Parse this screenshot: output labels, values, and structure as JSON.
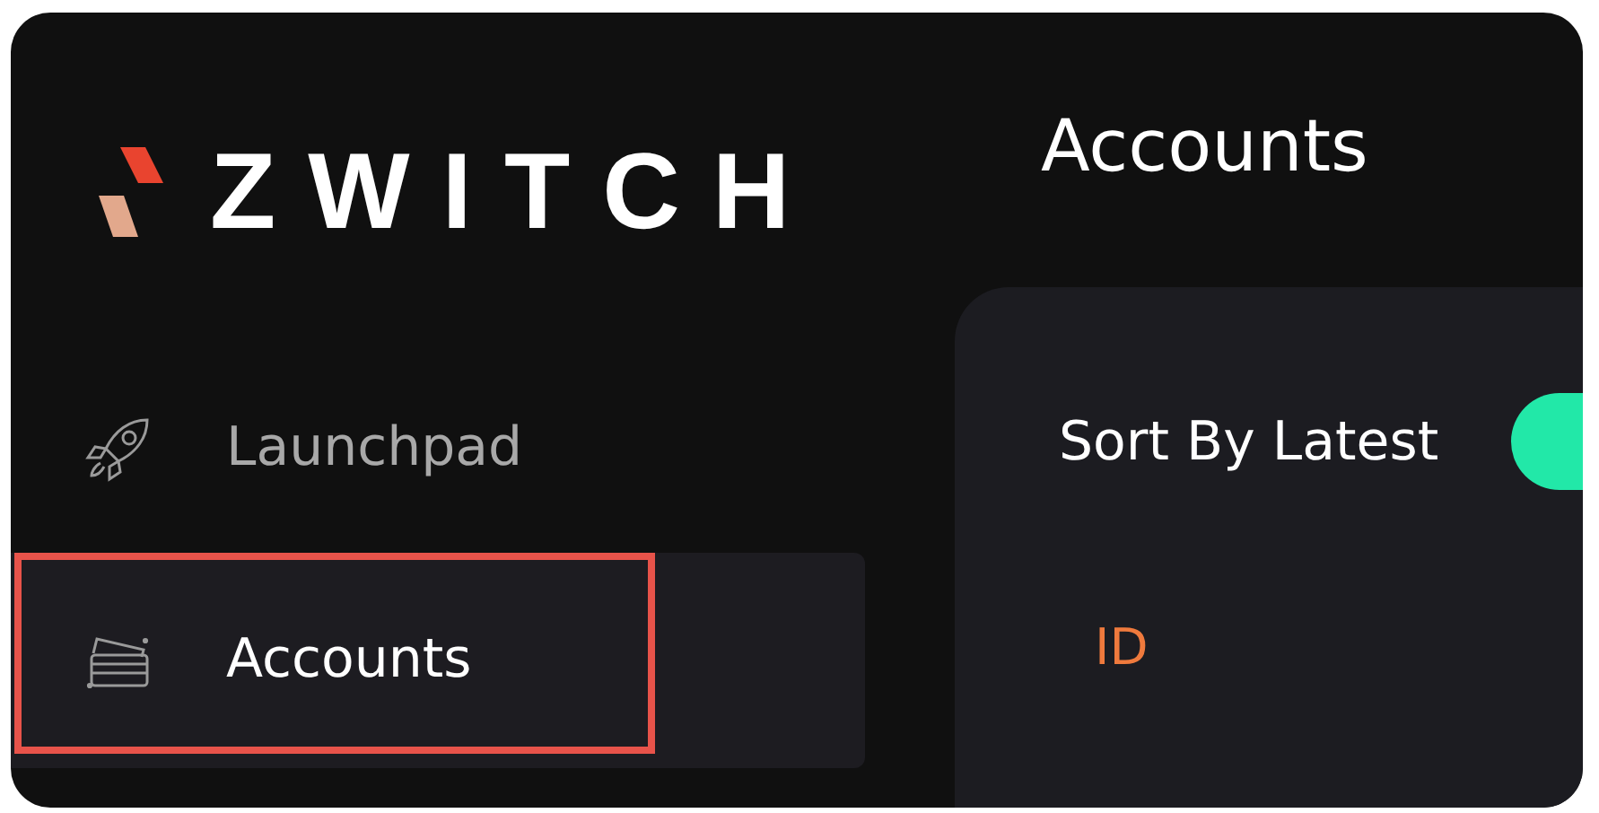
{
  "logo": {
    "text": "ZWITCH"
  },
  "page_title": "Accounts",
  "sidebar": {
    "items": [
      {
        "label": "Launchpad",
        "kind": "rocket",
        "selected": false
      },
      {
        "label": "Accounts",
        "kind": "cards",
        "selected": true
      }
    ]
  },
  "sort_toggle": {
    "label": "Sort By Latest",
    "on": true
  },
  "table": {
    "columns": [
      "ID"
    ]
  }
}
